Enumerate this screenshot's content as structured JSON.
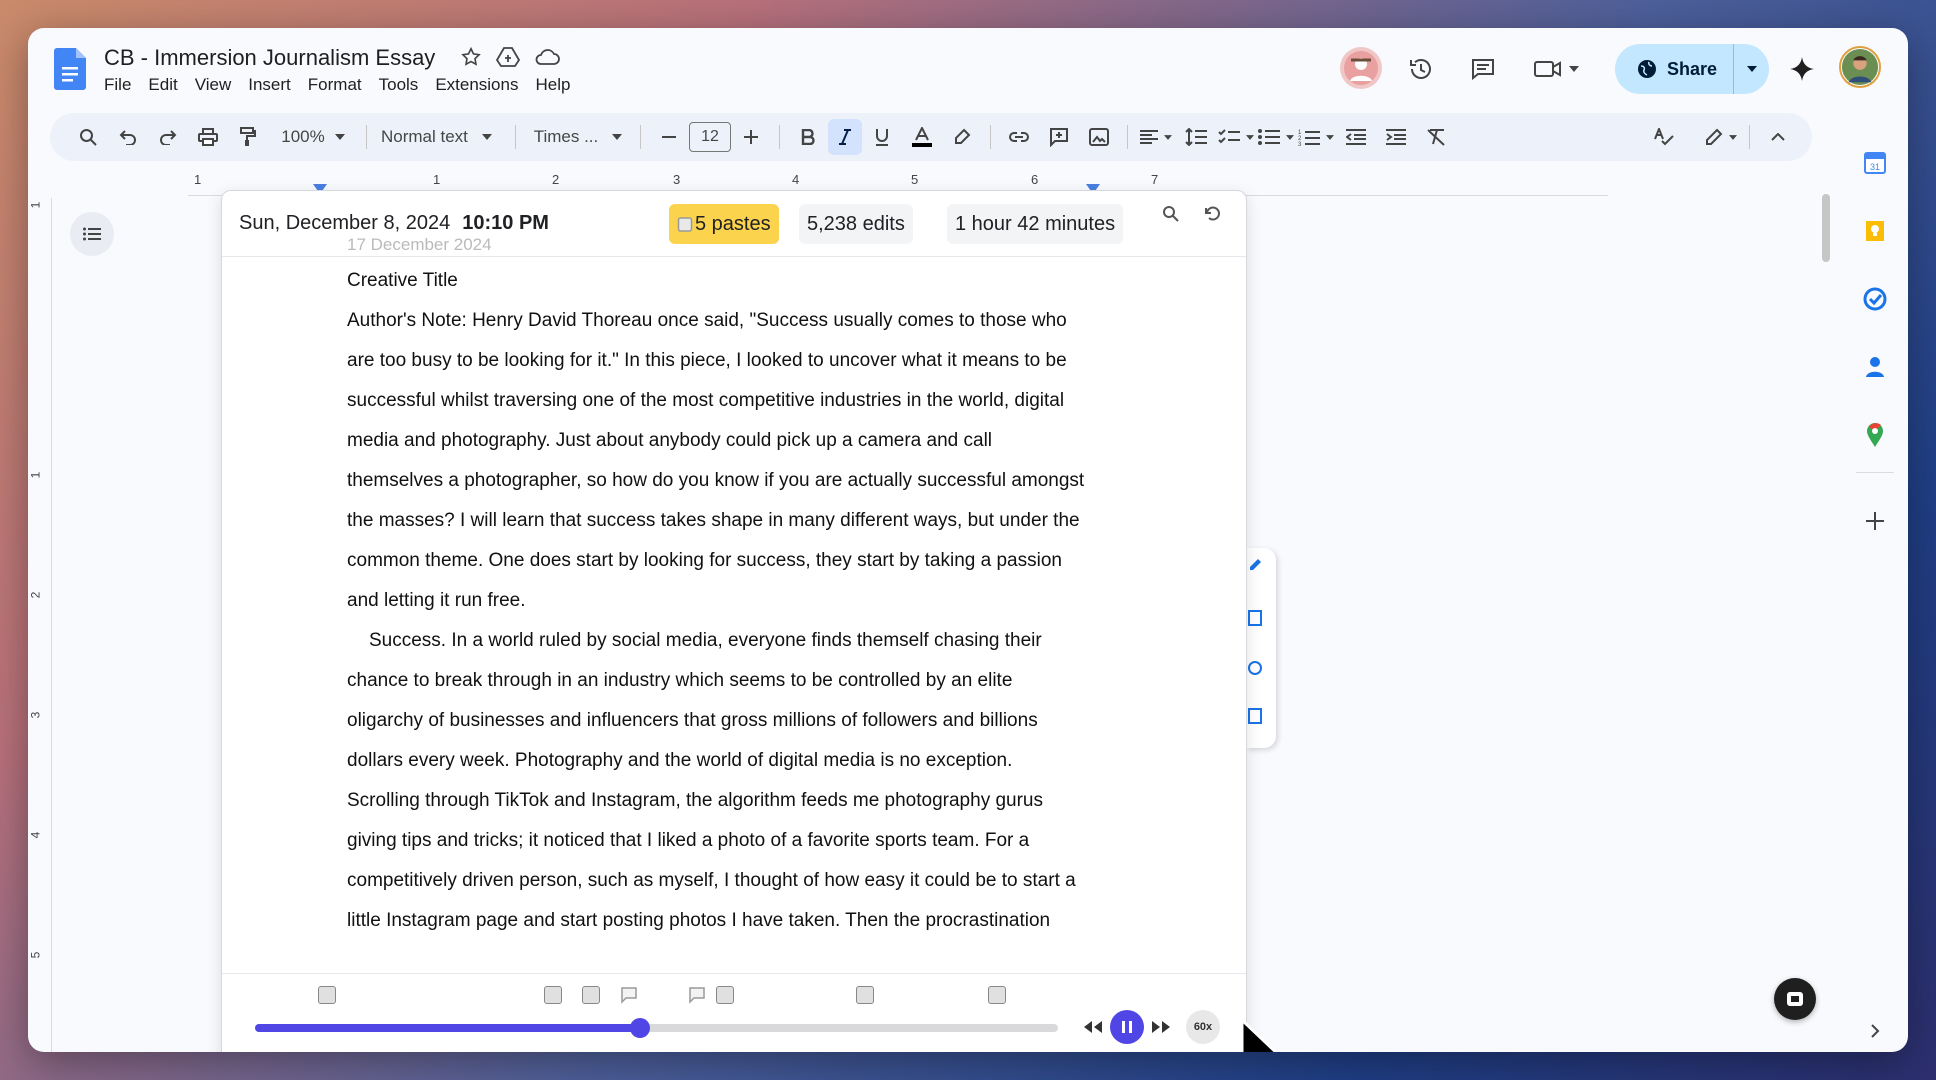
{
  "doc": {
    "title": "CB - Immersion Journalism Essay",
    "menu": [
      "File",
      "Edit",
      "View",
      "Insert",
      "Format",
      "Tools",
      "Extensions",
      "Help"
    ]
  },
  "header": {
    "share_label": "Share"
  },
  "toolbar": {
    "zoom": "100%",
    "style": "Normal text",
    "font": "Times ...",
    "font_size": "12"
  },
  "ruler": {
    "h_labels": [
      "1",
      "1",
      "2",
      "3",
      "4",
      "5",
      "6",
      "7"
    ],
    "v_labels": [
      "1",
      "1",
      "2",
      "3",
      "4",
      "5"
    ]
  },
  "replay": {
    "date": "Sun, December 8, 2024",
    "time": "10:10 PM",
    "pastes": "5  pastes",
    "edits": "5,238  edits",
    "duration": "1 hour 42 minutes",
    "speed": "60x",
    "progress": 0.48
  },
  "essay": {
    "cut_top": "17 December 2024",
    "title_line": "Creative Title",
    "lines": [
      "Author's Note: Henry David Thoreau once said, \"Success usually comes to those who",
      "are too busy to be looking for it.\" In this piece, I looked to uncover what it means to be",
      "successful whilst traversing one of the most competitive industries in the world, digital",
      "media and photography. Just about anybody could pick up a camera and call",
      "themselves a photographer, so how do you know if you are actually successful amongst",
      "the masses? I will learn that success takes shape in many different ways, but under the",
      "common theme. One does start by looking for success, they start by taking a passion",
      "and letting it run free.",
      "Success. In a world ruled by social media, everyone finds themself chasing their",
      "chance to break through in an industry which seems to be controlled by an elite",
      "oligarchy of businesses and influencers that gross millions of followers and billions",
      "dollars every week. Photography and the world of digital media is no exception.",
      "Scrolling through TikTok and Instagram, the algorithm feeds me photography gurus",
      "giving tips and tricks; it noticed that I liked a photo of a favorite sports team. For a",
      "competitively driven person, such as myself, I thought of how easy it could be to start a",
      "little Instagram page and start posting photos I have taken. Then the procrastination"
    ]
  },
  "colors": {
    "accent": "#5046e5",
    "paste_chip": "#fbd34d",
    "share_bg": "#c2e7ff"
  }
}
